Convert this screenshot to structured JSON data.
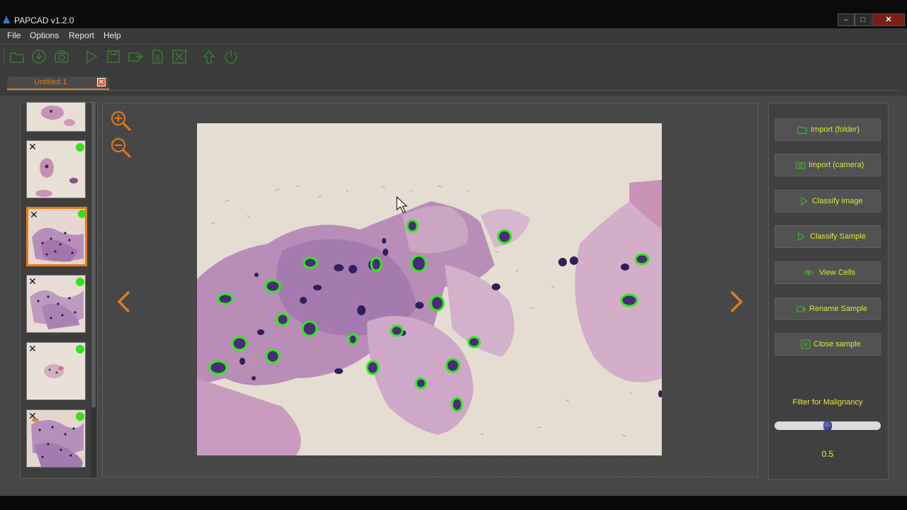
{
  "window": {
    "title": "PAPCAD  v1.2.0",
    "controls": {
      "minimize": "–",
      "maximize": "□",
      "close": "✕"
    }
  },
  "menu": [
    "File",
    "Options",
    "Report",
    "Help"
  ],
  "toolbar_icons": [
    "open-folder-icon",
    "download-icon",
    "camera-icon",
    "play-icon",
    "save-icon",
    "export-icon",
    "document-icon",
    "close-file-icon",
    "upload-icon",
    "power-icon"
  ],
  "tab": {
    "label": "Untitled 1",
    "close": "✕"
  },
  "thumbnails": [
    {
      "close": "",
      "status": "none",
      "selected": false
    },
    {
      "close": "✕",
      "status": "classified",
      "selected": false
    },
    {
      "close": "✕",
      "status": "classified",
      "selected": true
    },
    {
      "close": "✕",
      "status": "classified",
      "selected": false
    },
    {
      "close": "✕",
      "status": "classified",
      "selected": false
    },
    {
      "close": "✕",
      "status": "classified",
      "selected": false
    }
  ],
  "actions": {
    "import_folder": "Import (folder)",
    "import_camera": "Import (camera)",
    "classify_image": "Classify image",
    "classify_sample": "Classify Sample",
    "view_cells": "View Cells",
    "rename_sample": "Rename Sample",
    "close_sample": "Close sample"
  },
  "filter": {
    "label": "Filter for Malignancy",
    "value": "0.5",
    "level": 0.5
  },
  "colors": {
    "accent_orange": "#f07a12",
    "action_text": "#dde43a",
    "status_green": "#35e018",
    "cell_outline": "#28f013"
  }
}
